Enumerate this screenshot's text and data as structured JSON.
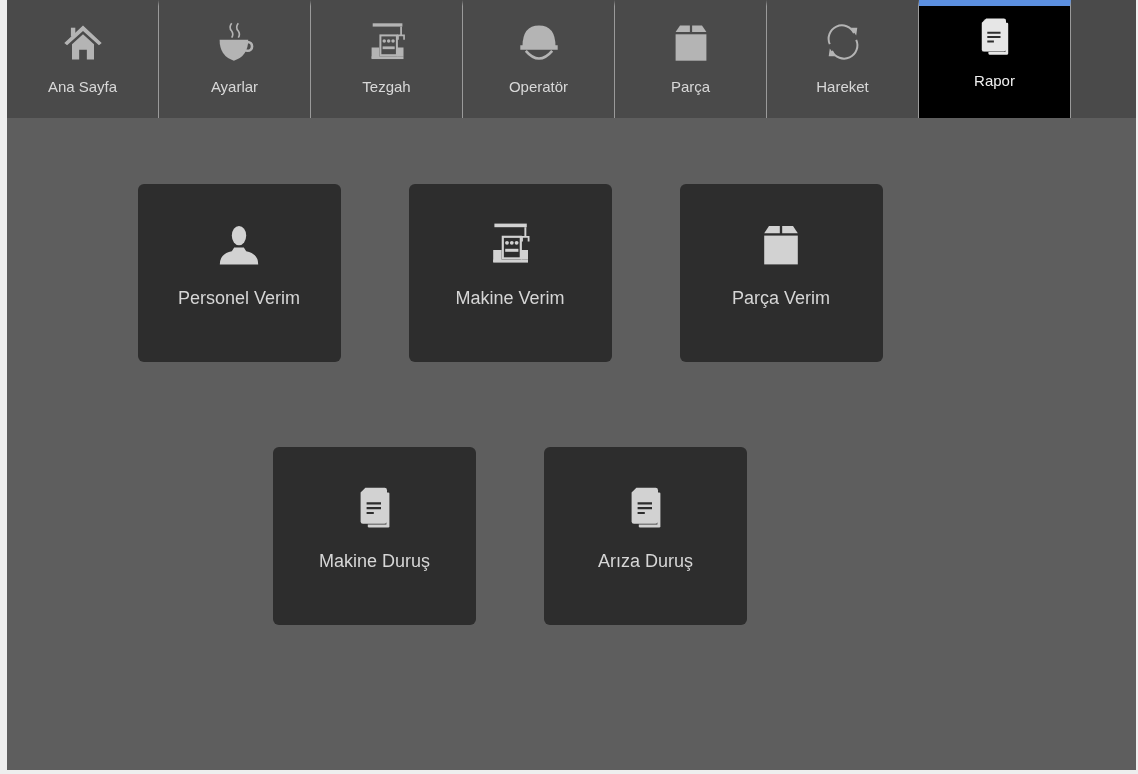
{
  "tabs": [
    {
      "label": "Ana Sayfa",
      "selected": false
    },
    {
      "label": "Ayarlar",
      "selected": false
    },
    {
      "label": "Tezgah",
      "selected": false
    },
    {
      "label": "Operatör",
      "selected": false
    },
    {
      "label": "Parça",
      "selected": false
    },
    {
      "label": "Hareket",
      "selected": false
    },
    {
      "label": "Rapor",
      "selected": true
    }
  ],
  "tile_rows": [
    {
      "tiles": [
        {
          "label": "Personel Verim"
        },
        {
          "label": "Makine Verim"
        },
        {
          "label": "Parça Verim"
        }
      ]
    },
    {
      "tiles": [
        {
          "label": "Makine Duruş"
        },
        {
          "label": "Arıza Duruş"
        }
      ]
    }
  ]
}
